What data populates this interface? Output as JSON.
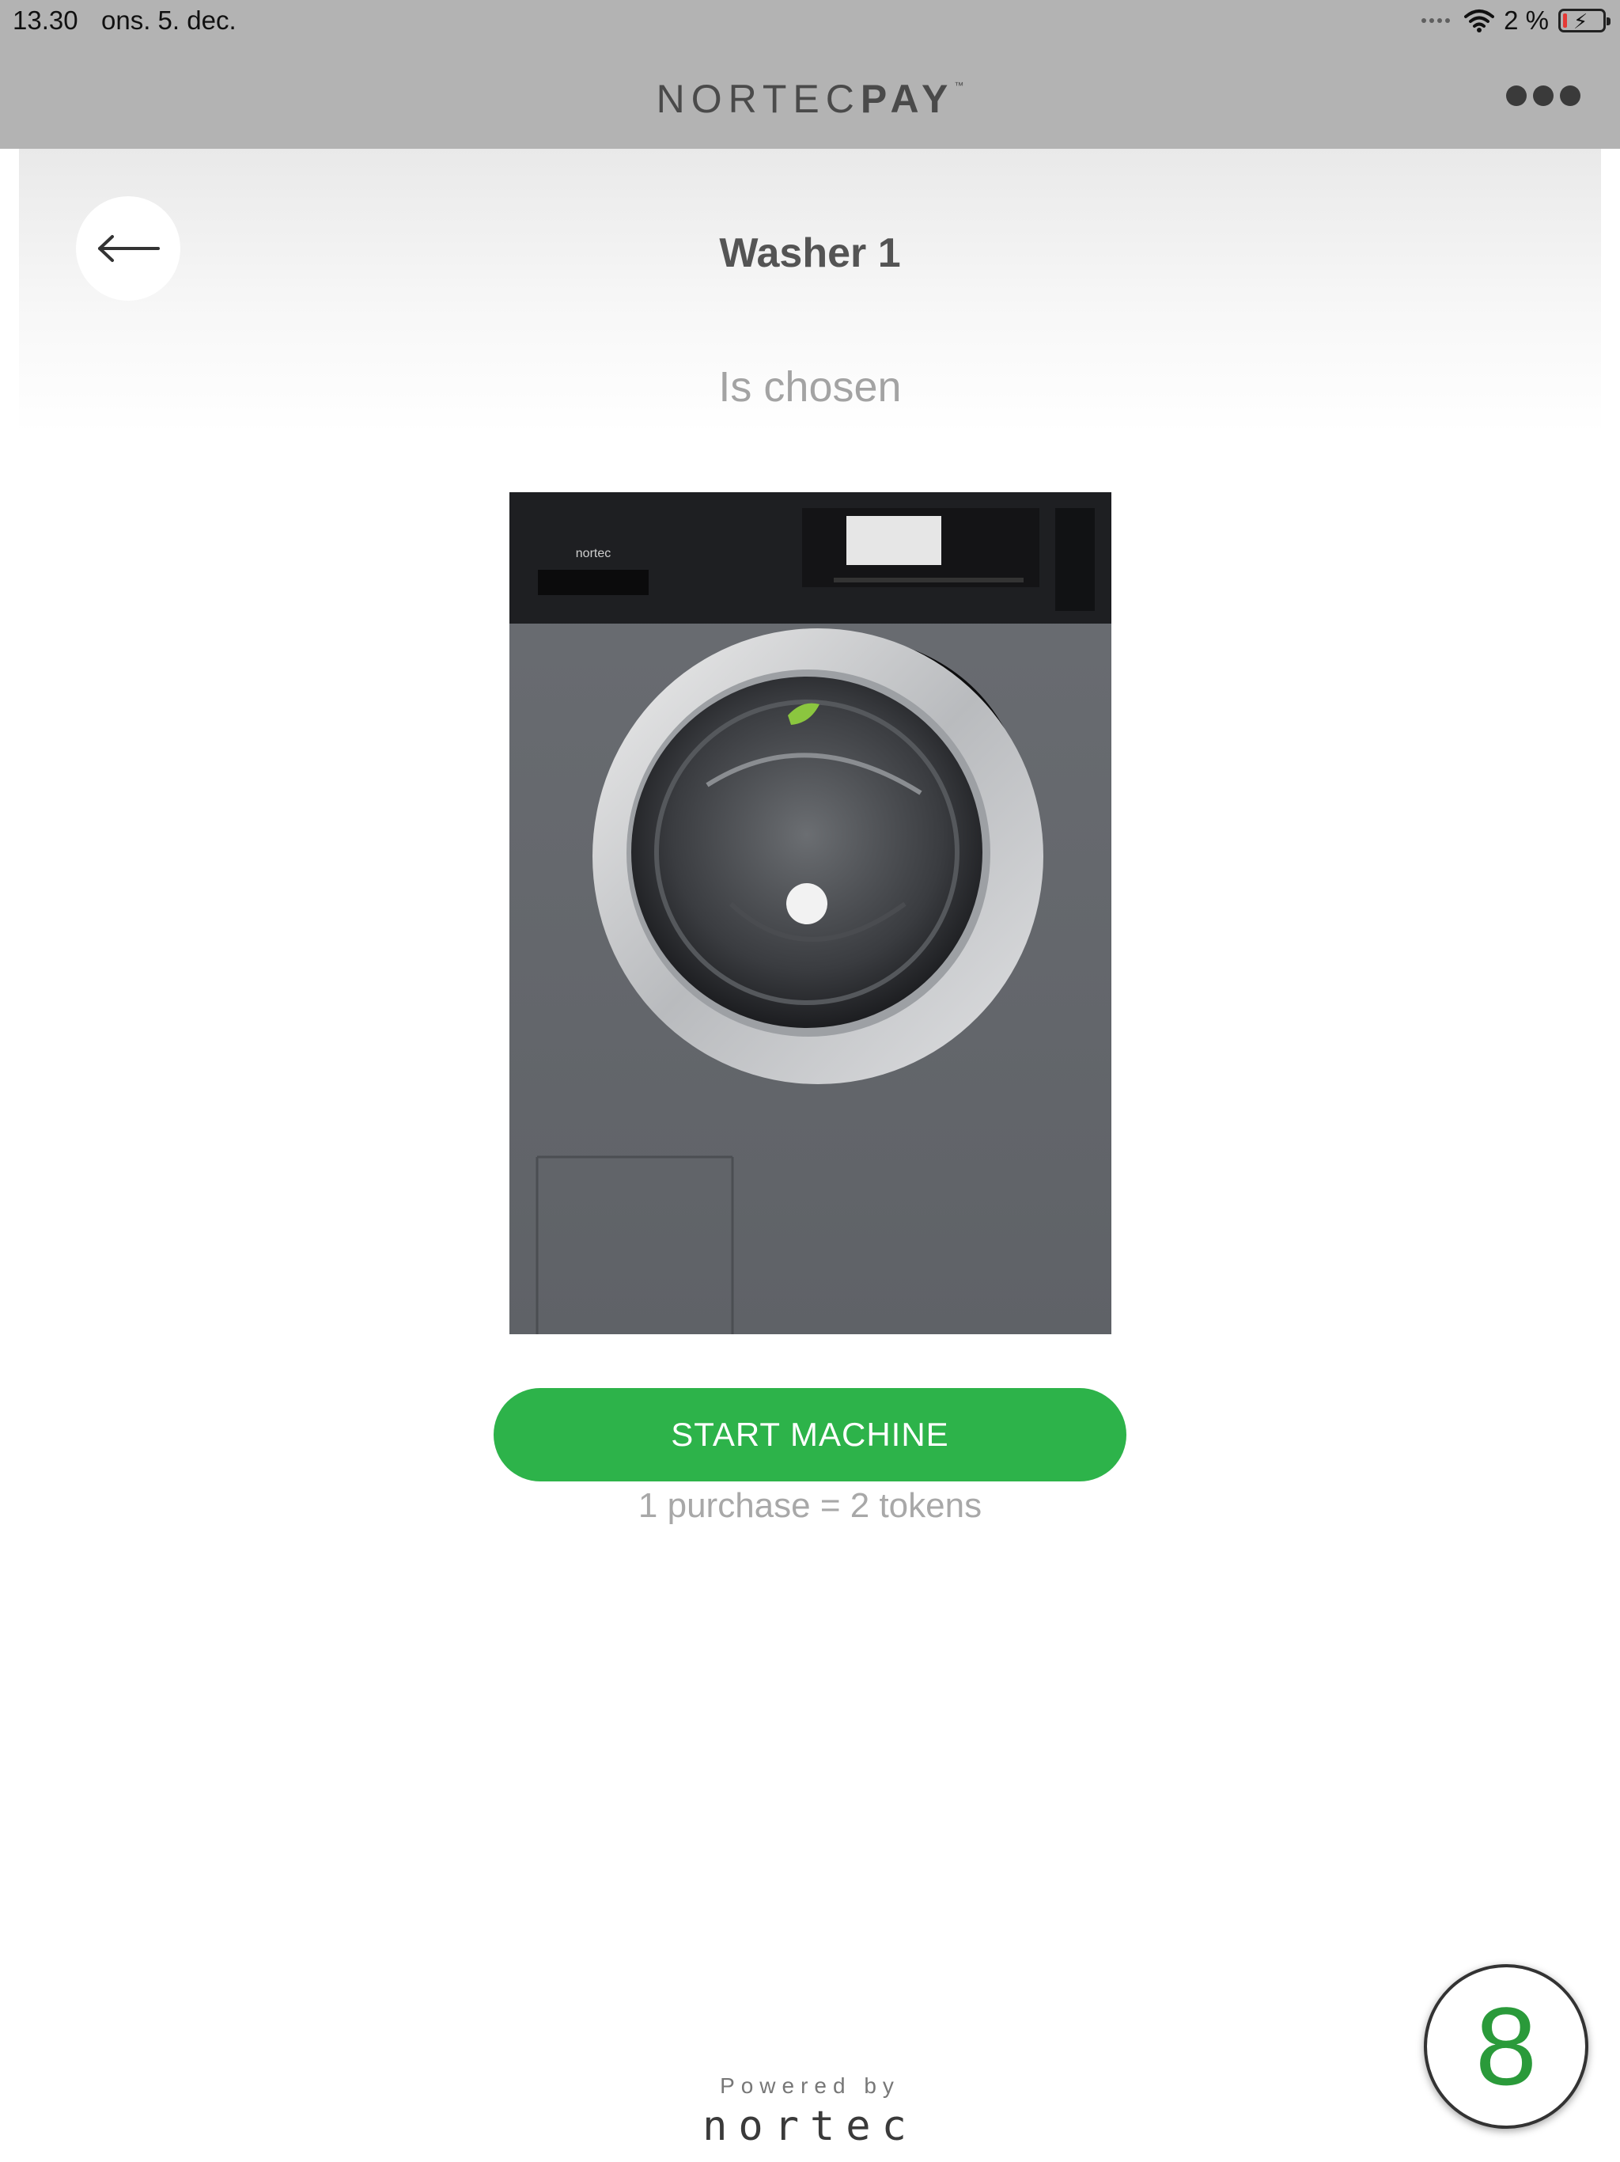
{
  "status_bar": {
    "time": "13.30",
    "date": "ons. 5. dec.",
    "battery": "2 %",
    "icons": [
      "signal-dots-icon",
      "wifi-icon",
      "battery-charging-icon"
    ]
  },
  "app_bar": {
    "brand_light": "NORTEC",
    "brand_bold": "PAY",
    "brand_mark": "™",
    "menu_icon": "more-dots-icon"
  },
  "machine_panel": {
    "back_icon": "arrow-left-icon",
    "title": "Washer 1",
    "subtitle": "Is chosen",
    "image_label": "washing-machine-image",
    "image_brand_text": "nortec"
  },
  "actions": {
    "start_label": "START MACHINE",
    "price_note": "1 purchase = 2 tokens"
  },
  "footer": {
    "powered_by": "Powered by",
    "logo_text": "nortec"
  },
  "token_badge": {
    "count": "8"
  },
  "colors": {
    "accent_green": "#2db34a",
    "header_gray": "#b3b3b3",
    "badge_green": "#2a9a3a"
  }
}
